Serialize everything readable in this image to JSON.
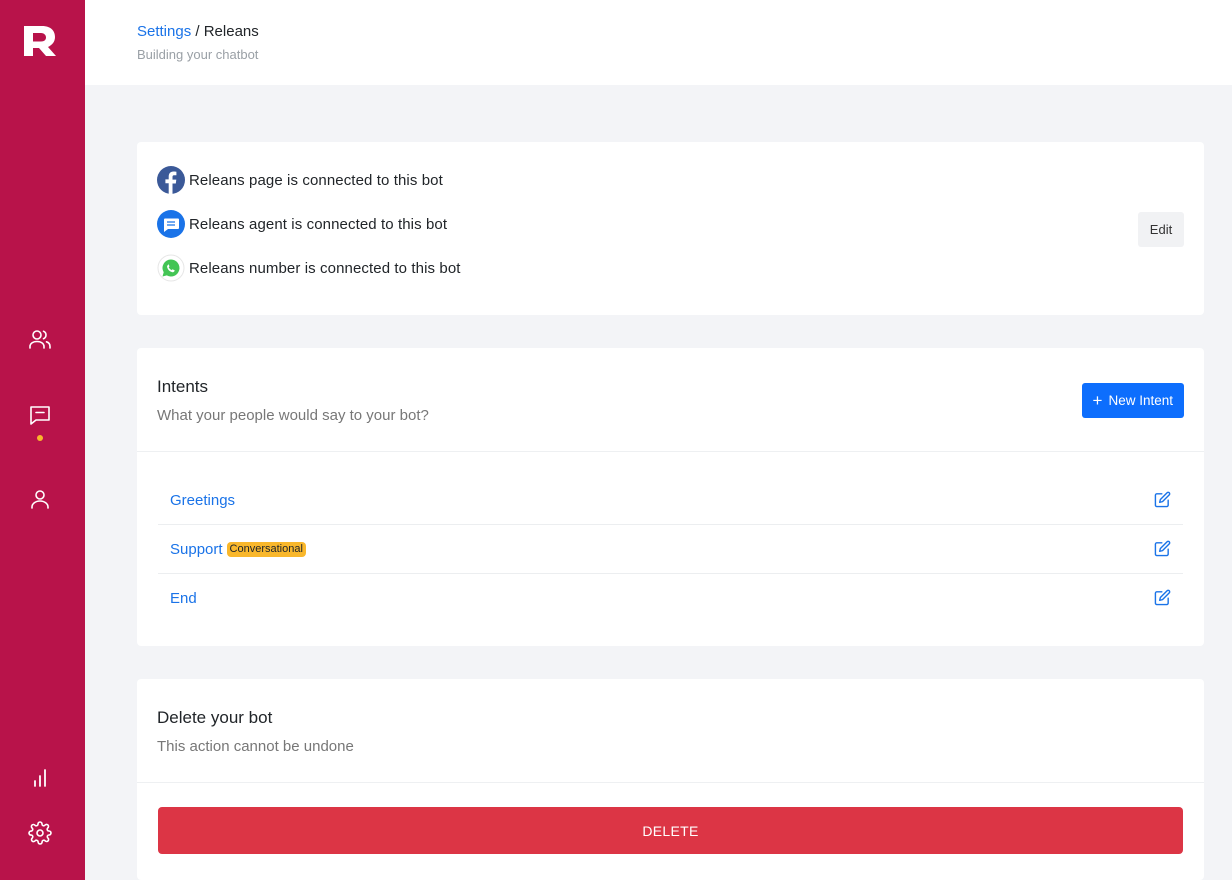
{
  "sidebar": {
    "logo": "R",
    "accent_color": "#b8134a",
    "active_dot_color": "#f9b72b",
    "items": [
      {
        "icon": "users-icon"
      },
      {
        "icon": "chat-icon",
        "active": true
      },
      {
        "icon": "user-icon"
      },
      {
        "icon": "bar-chart-icon"
      },
      {
        "icon": "gear-icon"
      }
    ]
  },
  "header": {
    "breadcrumb_link": "Settings",
    "breadcrumb_separator": " / ",
    "breadcrumb_current": "Releans",
    "subtitle": "Building your chatbot"
  },
  "connections": {
    "items": [
      {
        "icon": "facebook-icon",
        "text": "Releans page is connected to this bot"
      },
      {
        "icon": "message-icon",
        "text": "Releans agent is connected to this bot"
      },
      {
        "icon": "whatsapp-icon",
        "text": "Releans number is connected to this bot"
      }
    ],
    "edit_label": "Edit"
  },
  "intents": {
    "title": "Intents",
    "subtitle": "What your people would say to your bot?",
    "new_button_plus": "+",
    "new_button_label": "New Intent",
    "items": [
      {
        "label": "Greetings"
      },
      {
        "label": "Support",
        "badge": "Conversational"
      },
      {
        "label": "End"
      }
    ]
  },
  "delete_section": {
    "title": "Delete your bot",
    "subtitle": "This action cannot be undone",
    "button_label": "DELETE",
    "button_color": "#dc3545"
  }
}
